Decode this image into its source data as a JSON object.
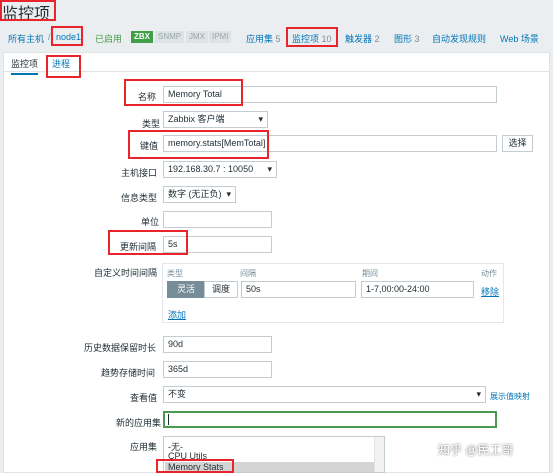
{
  "page_title": "监控项",
  "breadcrumb": {
    "all_hosts": "所有主机",
    "separator": "/",
    "host": "node1",
    "status": "已启用",
    "zbx": "ZBX",
    "snmp": "SNMP",
    "jmx": "JMX",
    "ipmi": "IPMI",
    "applications": "应用集",
    "applications_count": "5",
    "items": "监控项",
    "items_count": "10",
    "triggers": "触发器",
    "triggers_count": "2",
    "graphs": "图形",
    "graphs_count": "3",
    "discovery": "自动发现规则",
    "web": "Web 场景"
  },
  "tabs": [
    "监控项",
    "进程"
  ],
  "form": {
    "name_label": "名称",
    "name_value": "Memory Total",
    "type_label": "类型",
    "type_value": "Zabbix 客户端",
    "key_label": "键值",
    "key_value": "memory.stats[MemTotal]",
    "key_button": "选择",
    "interface_label": "主机接口",
    "interface_value": "192.168.30.7 : 10050",
    "info_type_label": "信息类型",
    "info_type_value": "数字 (无正负)",
    "units_label": "单位",
    "units_value": "",
    "update_label": "更新间隔",
    "update_value": "5s",
    "custom_label": "自定义时间间隔",
    "custom": {
      "col_type": "类型",
      "col_interval": "间隔",
      "col_period": "期间",
      "col_action": "动作",
      "flexible": "灵活",
      "scheduling": "调度",
      "interval_value": "50s",
      "period_value": "1-7,00:00-24:00",
      "remove": "移除",
      "add": "添加"
    },
    "history_label": "历史数据保留时长",
    "history_value": "90d",
    "trends_label": "趋势存储时间",
    "trends_value": "365d",
    "valuemap_label": "查看值",
    "valuemap_value": "不变",
    "valuemap_link": "展示值映射",
    "new_app_label": "新的应用集",
    "new_app_value": "",
    "apps_label": "应用集",
    "apps_options": [
      "-无-",
      "CPU Utils",
      "Memory Stats"
    ]
  },
  "watermark": "知乎 @民工哥",
  "colors": {
    "annotation": "#e8252b",
    "link": "#0275b8",
    "enabled": "#429e47"
  }
}
